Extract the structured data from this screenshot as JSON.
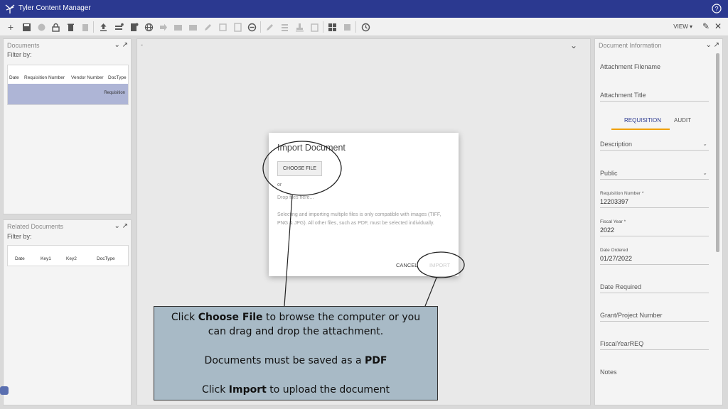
{
  "app": {
    "title": "Tyler Content Manager"
  },
  "toolbar": {
    "view_label": "VIEW"
  },
  "documents_panel": {
    "title": "Documents",
    "filter_label": "Filter by:",
    "columns": [
      "Date",
      "Requisition Number",
      "Vendor Number",
      "DocType"
    ],
    "selected_row_doctype": "Requisition"
  },
  "related_panel": {
    "title": "Related Documents",
    "filter_label": "Filter by:",
    "columns": [
      "Date",
      "Key1",
      "Key2",
      "DocType"
    ]
  },
  "main": {
    "breadcrumb": "-"
  },
  "info_panel": {
    "title": "Document Information",
    "attachment_filename_label": "Attachment Filename",
    "attachment_title_label": "Attachment Title",
    "tabs": [
      "REQUISITION",
      "AUDIT"
    ],
    "description_label": "Description",
    "public_label": "Public",
    "requisition_number_label": "Requisition Number *",
    "requisition_number_value": "12203397",
    "fiscal_year_label": "Fiscal Year *",
    "fiscal_year_value": "2022",
    "date_ordered_label": "Date Ordered",
    "date_ordered_value": "01/27/2022",
    "date_required_label": "Date Required",
    "grant_project_label": "Grant/Project Number",
    "fiscal_year_req_label": "FiscalYearREQ",
    "notes_label": "Notes"
  },
  "modal": {
    "title": "Import Document",
    "choose_file_label": "CHOOSE FILE",
    "or_text": "or",
    "drop_text": "Drop files here...",
    "note": "Selecting and importing multiple files is only compatible with images (TIFF, PNG & JPG). All other files, such as PDF, must be selected individually.",
    "cancel_label": "CANCEL",
    "import_label": "IMPORT"
  },
  "callout": {
    "line1_pre": "Click ",
    "line1_bold": "Choose File",
    "line1_post": " to browse the computer or you",
    "line2": "can drag and drop the attachment.",
    "line3_pre": "Documents must be saved as a ",
    "line3_bold": "PDF",
    "line4_pre": "Click ",
    "line4_bold": "Import",
    "line4_post": " to upload the document"
  },
  "colors": {
    "titlebar": "#2b3990",
    "selection": "#aeb5d6",
    "tab_underline": "#f0a000",
    "callout_bg": "#a8bac6"
  }
}
